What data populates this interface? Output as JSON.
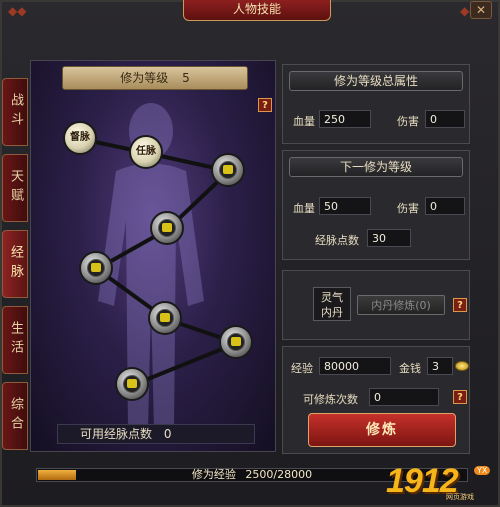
{
  "window": {
    "title": "人物技能",
    "close_label": "✕"
  },
  "tabs": [
    {
      "label": "战斗",
      "active": false
    },
    {
      "label": "天赋",
      "active": false
    },
    {
      "label": "经脉",
      "active": true
    },
    {
      "label": "生活",
      "active": false
    },
    {
      "label": "综合",
      "active": false
    }
  ],
  "meridian": {
    "level_label": "修为等级",
    "level_value": "5",
    "help_label": "?",
    "nodes": [
      {
        "label": "督脉",
        "unlocked": true
      },
      {
        "label": "任脉",
        "unlocked": true
      },
      {
        "label": "",
        "unlocked": false
      },
      {
        "label": "",
        "unlocked": false
      },
      {
        "label": "",
        "unlocked": false
      },
      {
        "label": "",
        "unlocked": false
      },
      {
        "label": "",
        "unlocked": false
      },
      {
        "label": "",
        "unlocked": false
      }
    ],
    "available_points_label": "可用经脉点数",
    "available_points_value": "0"
  },
  "total_attributes": {
    "header": "修为等级总属性",
    "hp_label": "血量",
    "hp_value": "250",
    "damage_label": "伤害",
    "damage_value": "0"
  },
  "next_level": {
    "header": "下一修为等级",
    "hp_label": "血量",
    "hp_value": "50",
    "damage_label": "伤害",
    "damage_value": "0",
    "points_label": "经脉点数",
    "points_value": "30"
  },
  "inner_elixir": {
    "label_line1": "灵气",
    "label_line2": "内丹",
    "button_label": "内丹修炼(0)",
    "help_label": "?"
  },
  "cultivation": {
    "exp_label": "经验",
    "exp_value": "80000",
    "gold_label": "金钱",
    "gold_value": "3",
    "times_label": "可修炼次数",
    "times_value": "0",
    "help_label": "?",
    "train_button": "修炼"
  },
  "exp_bar": {
    "label": "修为经验",
    "value_text": "2500/28000",
    "current": 2500,
    "max": 28000
  },
  "logo": {
    "text": "1912",
    "badge": "YX",
    "subtitle": "网页游戏"
  },
  "colors": {
    "accent_red": "#8d1f1f",
    "gold": "#f6b51a",
    "panel_purple": "#4f3a78"
  }
}
